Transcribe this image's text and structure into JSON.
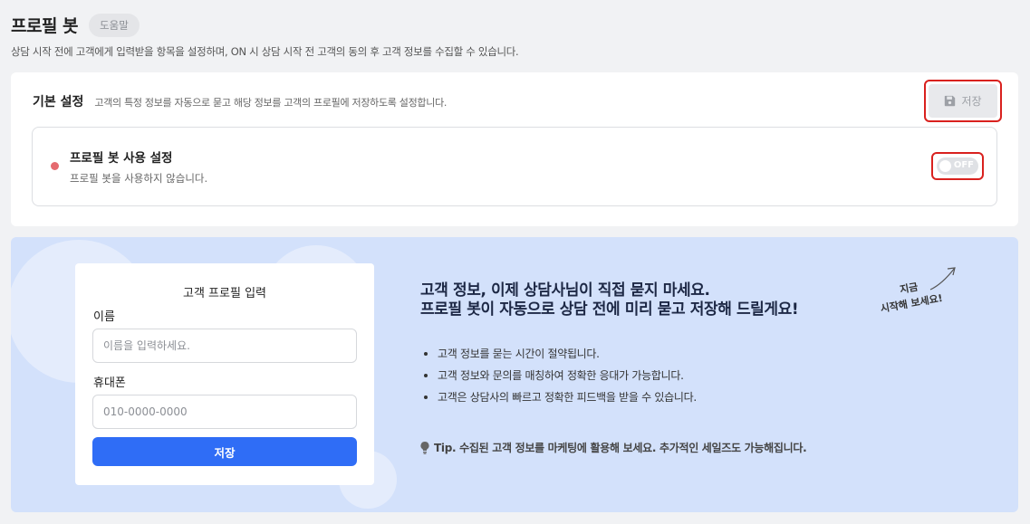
{
  "header": {
    "title": "프로필 봇",
    "help_label": "도움말",
    "description": "상담 시작 전에 고객에게 입력받을 항목을 설정하며, ON 시 상담 시작 전 고객의 동의 후 고객 정보를 수집할 수 있습니다."
  },
  "basic_settings": {
    "title": "기본 설정",
    "description": "고객의 특정 정보를 자동으로 묻고 해당 정보를 고객의 프로필에 저장하도록 설정합니다.",
    "save_label": "저장",
    "save_icon": "floppy-disk-icon"
  },
  "profile_bot_setting": {
    "title": "프로필 봇 사용 설정",
    "status_text": "프로필 봇을 사용하지 않습니다.",
    "toggle_label": "OFF",
    "toggle_on": false,
    "status_color": "#e56a6f"
  },
  "preview_form": {
    "title": "고객 프로필 입력",
    "name_label": "이름",
    "name_placeholder": "이름을 입력하세요.",
    "phone_label": "휴대폰",
    "phone_placeholder": "010-0000-0000",
    "submit_label": "저장"
  },
  "promo": {
    "headline_line1": "고객 정보, 이제 상담사님이 직접 묻지 마세요.",
    "headline_line2": "프로필 봇이 자동으로 상담 전에 미리 묻고 저장해 드릴게요!",
    "benefits": [
      "고객 정보를 묻는 시간이 절약됩니다.",
      "고객 정보와 문의를 매칭하여 정확한 응대가 가능합니다.",
      "고객은 상담사의 빠르고 정확한 피드백을 받을 수 있습니다."
    ],
    "tip": "Tip. 수집된 고객 정보를 마케팅에 활용해 보세요. 추가적인 세일즈도 가능해집니다.",
    "cta_line1": "지금",
    "cta_line2": "시작해 보세요!"
  },
  "colors": {
    "accent": "#2f6df6",
    "highlight_border": "#d9211e",
    "promo_background": "#d3e1fb"
  }
}
